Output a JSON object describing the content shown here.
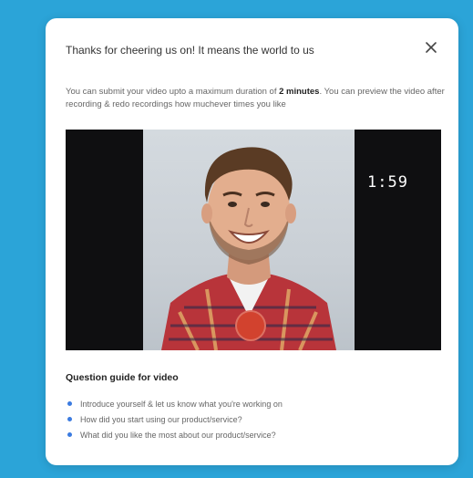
{
  "modal": {
    "title": "Thanks for cheering us on! It means the world to us",
    "description_pre": "You can submit your video upto a maximum duration of ",
    "description_bold": "2 minutes",
    "description_post": ". You can preview the video after recording & redo recordings how muchever times you like"
  },
  "video": {
    "timer": "1:59"
  },
  "guide": {
    "title": "Question guide for video",
    "items": [
      "Introduce yourself & let us know what you're working on",
      "How did you start using our product/service?",
      "What did you like the most about our product/service?"
    ]
  },
  "colors": {
    "background": "#2ba4d8",
    "record": "#d2422e",
    "bullet": "#3b7be0"
  },
  "icons": {
    "close": "close-icon",
    "record": "record-button"
  }
}
